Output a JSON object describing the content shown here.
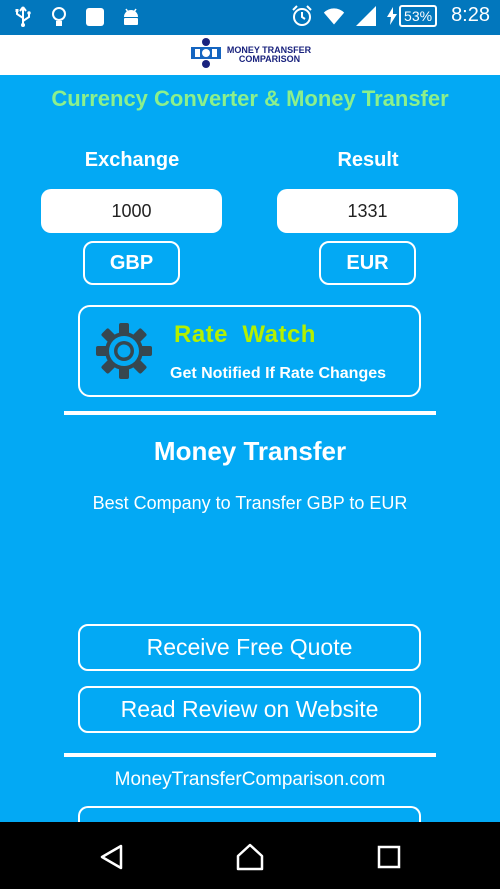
{
  "status_bar": {
    "left_icons": [
      "usb-icon",
      "lightbulb-icon",
      "app-square-icon",
      "android-icon"
    ],
    "right_icons": [
      "alarm-icon",
      "wifi-icon",
      "cellular-signal-icon",
      "battery-charging-icon"
    ],
    "battery_percent": "53%",
    "time": "8:28"
  },
  "header": {
    "logo_line1": "MONEY TRANSFER",
    "logo_line2": "COMPARISON"
  },
  "app_title": "Currency Converter & Money Transfer",
  "converter": {
    "exchange_label": "Exchange",
    "result_label": "Result",
    "exchange_value": "1000",
    "result_value": "1331",
    "from_currency": "GBP",
    "to_currency": "EUR"
  },
  "rate_watch": {
    "title": "Rate  Watch",
    "subtitle": "Get Notified If Rate Changes",
    "icon": "gear-icon"
  },
  "money_transfer": {
    "heading": "Money Transfer",
    "subtitle": "Best Company to Transfer GBP to EUR"
  },
  "actions": {
    "quote_label": "Receive Free Quote",
    "review_label": "Read Review on Website"
  },
  "footer": {
    "website": "MoneyTransferComparison.com"
  },
  "nav_bar": {
    "icons": [
      "back-icon",
      "home-icon",
      "recents-icon"
    ]
  },
  "colors": {
    "background": "#03a9f4",
    "status_bar": "#0277bd",
    "title_green": "#8cf08c",
    "rate_watch_green": "#b4f000"
  }
}
